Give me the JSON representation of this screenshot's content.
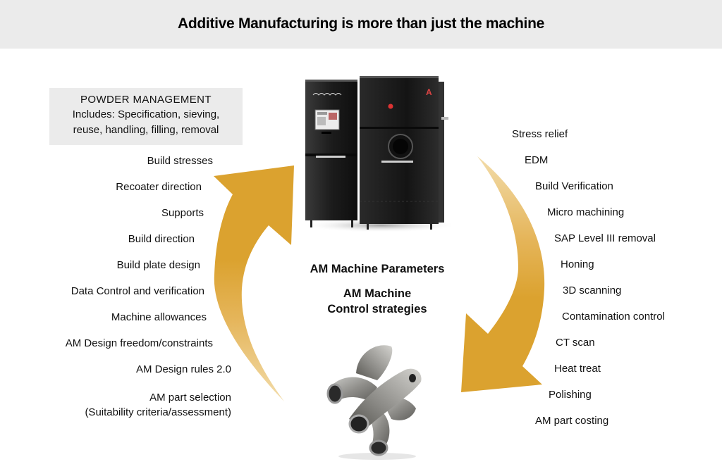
{
  "header": {
    "title": "Additive Manufacturing is more than just the machine"
  },
  "powder_management": {
    "title": "POWDER MANAGEMENT",
    "lines": [
      "Includes: Specification, sieving,",
      "reuse, handling, filling, removal"
    ]
  },
  "pre_process_items": [
    "Build stresses",
    "Recoater direction",
    "Supports",
    "Build direction",
    "Build plate design",
    "Data Control and verification",
    "Machine allowances",
    "AM Design freedom/constraints",
    "AM Design rules 2.0",
    "AM part selection",
    "(Suitability criteria/assessment)"
  ],
  "post_process_items": [
    "Stress relief",
    "EDM",
    "Build Verification",
    "Micro machining",
    "SAP Level III removal",
    "Honing",
    "3D scanning",
    "Contamination control",
    "CT scan",
    "Heat treat",
    "Polishing",
    "AM part costing"
  ],
  "center": {
    "parameters": "AM Machine Parameters",
    "control_line1": "AM Machine",
    "control_line2": "Control strategies"
  },
  "images": {
    "machine": "metal-am-machine-photo",
    "machine_brand_text": "arcam",
    "part": "printed-metal-part-photo"
  },
  "colors": {
    "header_bg": "#ebebeb",
    "arrow_gold": "#dba22f",
    "arrow_light": "#efd59a",
    "text": "#111111"
  }
}
